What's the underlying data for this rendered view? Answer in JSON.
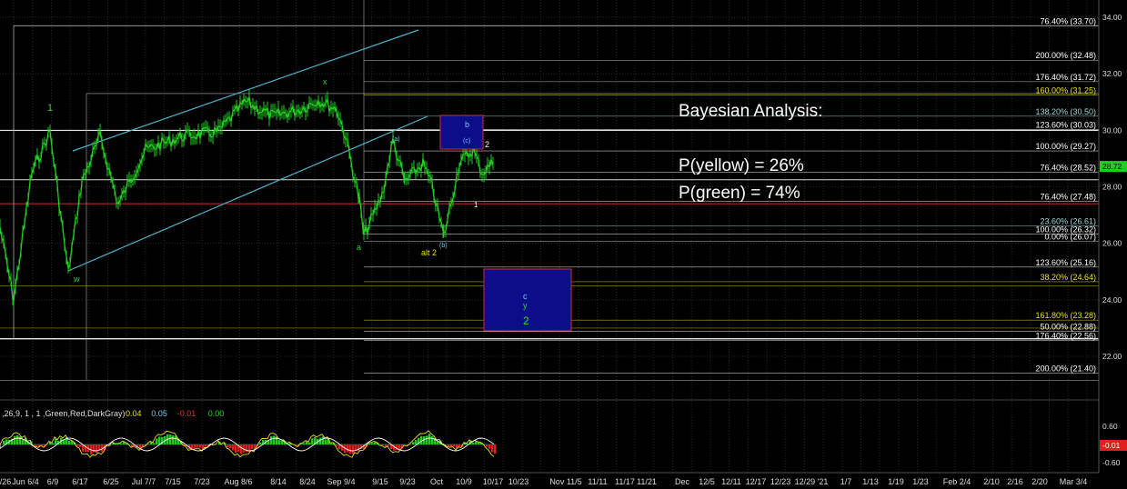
{
  "analysis": {
    "title": "Bayesian Analysis:",
    "line1": "P(yellow) = 26%",
    "line2": "P(green) = 74%"
  },
  "price_axis": {
    "ticks": [
      "34.00",
      "32.00",
      "30.00",
      "28.00",
      "26.00",
      "24.00",
      "22.00"
    ],
    "current_price": "28.72",
    "osc_ticks": [
      "0.60",
      "-0.60"
    ],
    "osc_current": "-0.01"
  },
  "time_axis": [
    "/26",
    "Jun 6/4",
    "6/9",
    "6/17",
    "6/25",
    "Jul 7/7",
    "7/15",
    "7/23",
    "Aug 8/6",
    "8/14",
    "8/24",
    "Sep 9/4",
    "9/15",
    "9/23",
    "Oct",
    "10/9",
    "10/17",
    "10/23",
    "Nov 11/5",
    "11/11",
    "11/17",
    "11/21",
    "Dec",
    "12/5",
    "12/11",
    "12/17",
    "12/23",
    "12/29 '21",
    "1/7",
    "1/13",
    "1/19",
    "1/23",
    "Feb 2/4",
    "2/10",
    "2/16",
    "2/20",
    "Mar 3/4"
  ],
  "fib_levels": [
    {
      "label": "76.40% (33.70)",
      "price": 33.7,
      "color": "#ffffff"
    },
    {
      "label": "200.00% (32.48)",
      "price": 32.48,
      "color": "#ffffff"
    },
    {
      "label": "176.40% (31.72)",
      "price": 31.72,
      "color": "#ffffff"
    },
    {
      "label": "160.00% (31.25)",
      "price": 31.25,
      "color": "#e8e020"
    },
    {
      "label": "138.20% (30.50)",
      "price": 30.5,
      "color": "#9fd8d8"
    },
    {
      "label": "123.60% (30.03)",
      "price": 30.03,
      "color": "#ffffff"
    },
    {
      "label": "100.00% (29.27)",
      "price": 29.27,
      "color": "#ffffff"
    },
    {
      "label": "76.40% (28.52)",
      "price": 28.52,
      "color": "#ffffff"
    },
    {
      "label": "76.40% (27.48)",
      "price": 27.48,
      "color": "#ffffff"
    },
    {
      "label": "23.60% (26.61)",
      "price": 26.61,
      "color": "#9fd8d8"
    },
    {
      "label": "100.00% (26.32)",
      "price": 26.32,
      "color": "#ffffff"
    },
    {
      "label": "0.00% (26.07)",
      "price": 26.07,
      "color": "#ffffff"
    },
    {
      "label": "123.60% (25.16)",
      "price": 25.16,
      "color": "#ffffff"
    },
    {
      "label": "38.20% (24.64)",
      "price": 24.64,
      "color": "#e8e020"
    },
    {
      "label": "161.80% (23.28)",
      "price": 23.28,
      "color": "#e8e020"
    },
    {
      "label": "50.00% (22.88)",
      "price": 22.88,
      "color": "#ffffff"
    },
    {
      "label": "176.40% (22.56)",
      "price": 22.56,
      "color": "#ffffff"
    },
    {
      "label": "200.00% (21.40)",
      "price": 21.4,
      "color": "#ffffff"
    }
  ],
  "wave_labels": [
    {
      "text": "1",
      "color": "#3ad13a"
    },
    {
      "text": "w",
      "color": "#3ad13a"
    },
    {
      "text": "x",
      "color": "#3ad13a"
    },
    {
      "text": "a",
      "color": "#3ad13a"
    },
    {
      "text": "(a)",
      "color": "#6ecbe8"
    },
    {
      "text": "(b)",
      "color": "#6ecbe8"
    },
    {
      "text": "(c)",
      "color": "#6ecbe8"
    },
    {
      "text": "b",
      "color": "#6ecbe8"
    },
    {
      "text": "2",
      "color": "#ffffff"
    },
    {
      "text": "1",
      "color": "#ffffff"
    },
    {
      "text": "alt 2",
      "color": "#e8e020"
    },
    {
      "text": "c",
      "color": "#6ecbe8"
    },
    {
      "text": "y",
      "color": "#3ad13a"
    },
    {
      "text": "2",
      "color": "#3ad13a"
    }
  ],
  "indicator_label": ",26,9, 1 , 1 ,Green,Red,DarkGray)",
  "indicator_values": [
    {
      "text": "0.04",
      "color": "#e8e020"
    },
    {
      "text": "0.05",
      "color": "#6ecbe8"
    },
    {
      "text": "-0.01",
      "color": "#e83030"
    },
    {
      "text": "0.00",
      "color": "#3ad13a"
    }
  ],
  "colors": {
    "price": "#22cc22",
    "channel": "#4fb3c8",
    "target_box": "#0d0d8a",
    "box_border": "#d03030"
  }
}
